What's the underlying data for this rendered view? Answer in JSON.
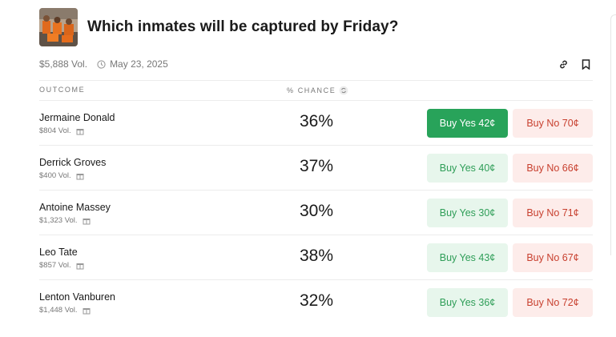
{
  "market": {
    "title": "Which inmates will be captured by Friday?",
    "volume": "$5,888 Vol.",
    "date": "May 23, 2025"
  },
  "columns": {
    "outcome": "OUTCOME",
    "chance": "% CHANCE"
  },
  "icons": {
    "clock": "clock-icon",
    "link": "link-icon",
    "bookmark": "bookmark-icon",
    "refresh": "refresh-icon",
    "gift": "gift-icon"
  },
  "colors": {
    "yes_active_bg": "#28a35a",
    "yes_bg": "#e7f6ec",
    "yes_text": "#2f9e58",
    "no_bg": "#fdecea",
    "no_text": "#c8402f"
  },
  "outcomes": [
    {
      "name": "Jermaine Donald",
      "volume": "$804 Vol.",
      "chance": "36%",
      "yes_label": "Buy Yes 42¢",
      "no_label": "Buy No 70¢"
    },
    {
      "name": "Derrick Groves",
      "volume": "$400 Vol.",
      "chance": "37%",
      "yes_label": "Buy Yes 40¢",
      "no_label": "Buy No 66¢"
    },
    {
      "name": "Antoine Massey",
      "volume": "$1,323 Vol.",
      "chance": "30%",
      "yes_label": "Buy Yes 30¢",
      "no_label": "Buy No 71¢"
    },
    {
      "name": "Leo Tate",
      "volume": "$857 Vol.",
      "chance": "38%",
      "yes_label": "Buy Yes 43¢",
      "no_label": "Buy No 67¢"
    },
    {
      "name": "Lenton Vanburen",
      "volume": "$1,448 Vol.",
      "chance": "32%",
      "yes_label": "Buy Yes 36¢",
      "no_label": "Buy No 72¢"
    }
  ]
}
